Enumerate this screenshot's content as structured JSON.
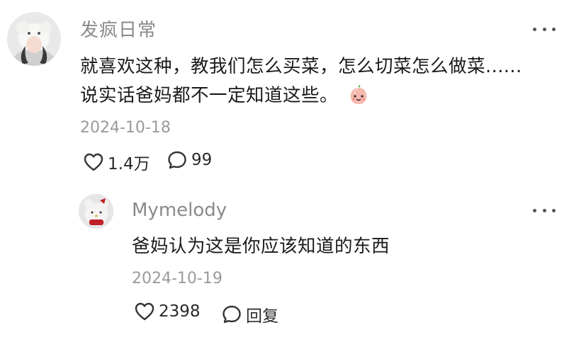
{
  "comment": {
    "author": "发疯日常",
    "text_line1": "就喜欢这种，教我们怎么买菜，怎么切菜怎么做菜......",
    "text_line2": "说实话爸妈都不一定知道这些。",
    "emoji": "smiling-peach-emoji",
    "date": "2024-10-18",
    "like_count": "1.4万",
    "comment_count": "99",
    "more_icon": "more-dots-icon"
  },
  "reply": {
    "author": "Mymelody",
    "text": "爸妈认为这是你应该知道的东西",
    "date": "2024-10-19",
    "like_count": "2398",
    "reply_label": "回复",
    "more_icon": "more-dots-icon"
  },
  "colors": {
    "name": "#8a8a8a",
    "date": "#9a9a9a",
    "text": "#1a1a1a",
    "icon": "#333333"
  }
}
